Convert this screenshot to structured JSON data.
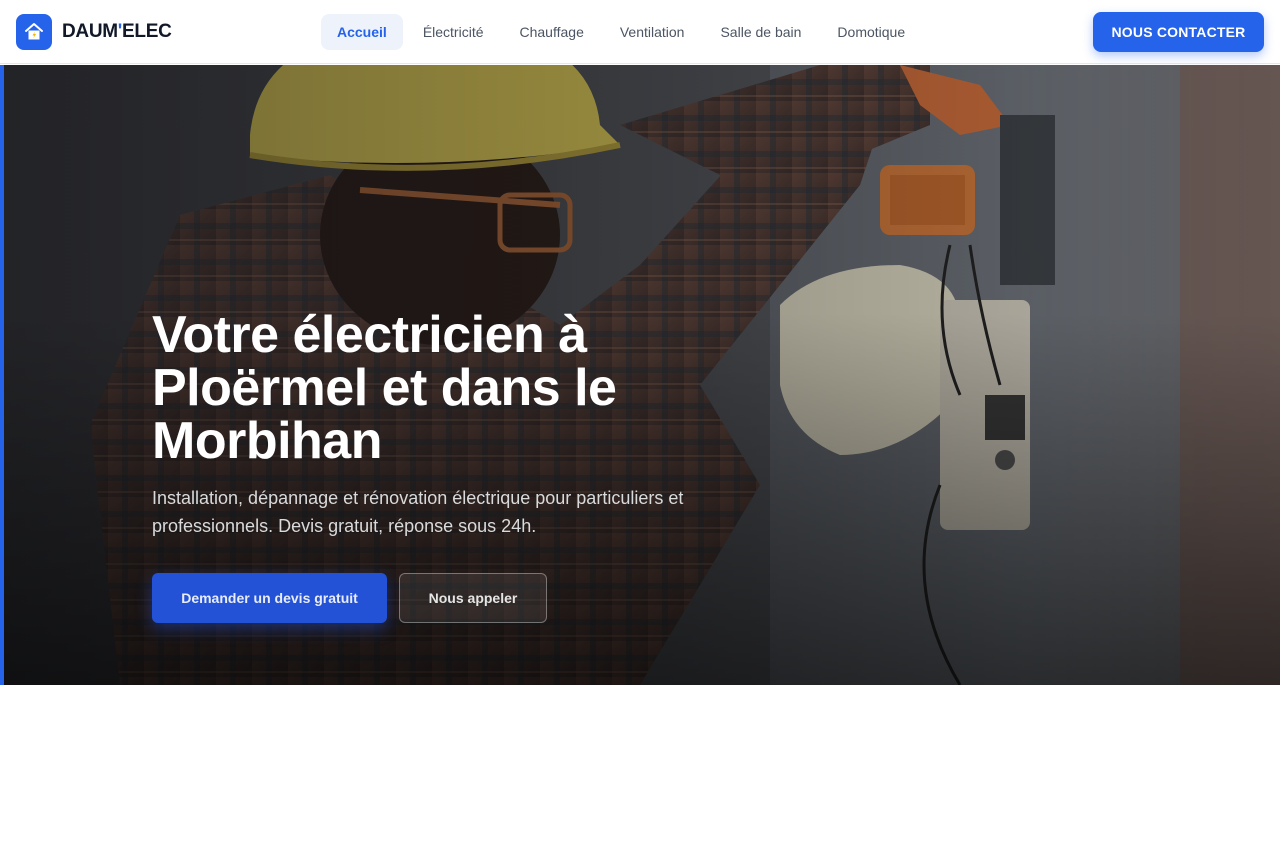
{
  "header": {
    "logo": {
      "icon": "house-icon",
      "brand_left": "DAUM",
      "brand_separator": "'",
      "brand_right": "ELEC"
    },
    "nav": [
      {
        "label": "Accueil",
        "active": true
      },
      {
        "label": "Électricité",
        "active": false
      },
      {
        "label": "Chauffage",
        "active": false
      },
      {
        "label": "Ventilation",
        "active": false
      },
      {
        "label": "Salle de bain",
        "active": false
      },
      {
        "label": "Domotique",
        "active": false
      }
    ],
    "cta_label": "NOUS CONTACTER"
  },
  "hero": {
    "title": "Votre électricien à Ploërmel et dans le Morbihan",
    "subtitle": "Installation, dépannage et rénovation électrique pour particuliers et professionnels. Devis gratuit, réponse sous 24h.",
    "primary_button": "Demander un devis gratuit",
    "secondary_button": "Nous appeler"
  },
  "colors": {
    "accent": "#2563eb",
    "text_dark": "#111827",
    "nav_active_bg": "#eef3fb"
  }
}
